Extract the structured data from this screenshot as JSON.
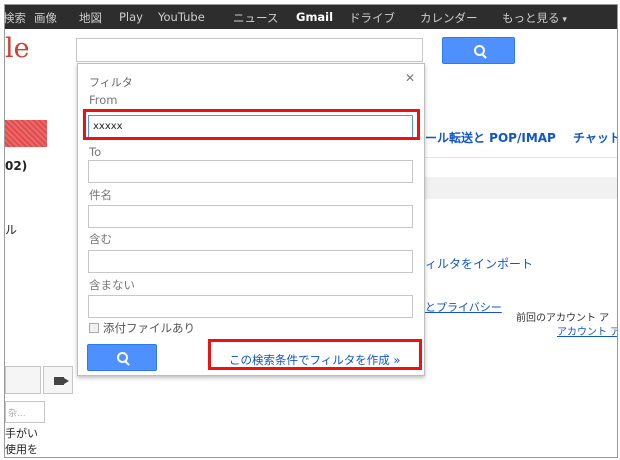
{
  "topbar": {
    "items": [
      "検索",
      "画像",
      "地図",
      "Play",
      "YouTube",
      "ニュース",
      "Gmail",
      "ドライブ",
      "カレンダー",
      "もっと見る"
    ]
  },
  "header": {
    "logo": "le"
  },
  "background": {
    "mail_settings_link": "ール転送と POP/IMAP",
    "chat_link": "チャット",
    "count_text": "02)",
    "fragment_l": "ル",
    "import_link": "ィルタをインポート",
    "privacy_link": "とプライバシー",
    "last_account_activity": "前回のアカウント ア",
    "account_link": "アカウント ア",
    "small_placeholder": "杂...",
    "side_text_1": "手がい",
    "side_text_2": "使用を"
  },
  "filter_panel": {
    "title": "フィルタ",
    "fields": [
      {
        "label": "From",
        "value": "xxxxx"
      },
      {
        "label": "To",
        "value": ""
      },
      {
        "label": "件名",
        "value": ""
      },
      {
        "label": "含む",
        "value": ""
      },
      {
        "label": "含まない",
        "value": ""
      }
    ],
    "has_attachment_label": "添付ファイルあり",
    "create_filter_link": "この検索条件でフィルタを作成 »"
  },
  "colors": {
    "accent": "#4d90fe",
    "highlight": "#ee1111",
    "topbar": "#2d2d2d"
  }
}
